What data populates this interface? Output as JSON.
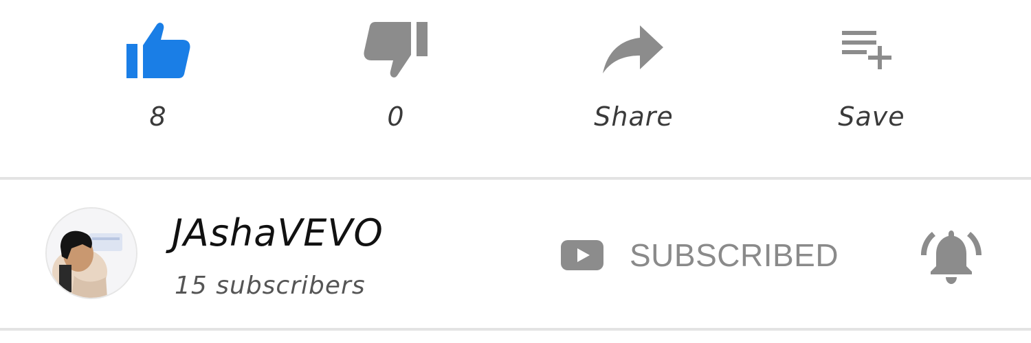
{
  "actions": {
    "like": {
      "label": "8",
      "color": "#1a7ee6",
      "icon": "thumbs-up-icon"
    },
    "dislike": {
      "label": "0",
      "color": "#8c8c8c",
      "icon": "thumbs-down-icon"
    },
    "share": {
      "label": "Share",
      "color": "#8c8c8c",
      "icon": "share-arrow-icon"
    },
    "save": {
      "label": "Save",
      "color": "#8c8c8c",
      "icon": "playlist-add-icon"
    }
  },
  "channel": {
    "name": "JAshaVEVO",
    "subscribers": "15 subscribers",
    "avatar": "channel-avatar"
  },
  "subscribe": {
    "label": "SUBSCRIBED",
    "icon": "youtube-play-icon",
    "color": "#8a8a8a"
  },
  "notifications": {
    "icon": "notification-bell-icon"
  }
}
